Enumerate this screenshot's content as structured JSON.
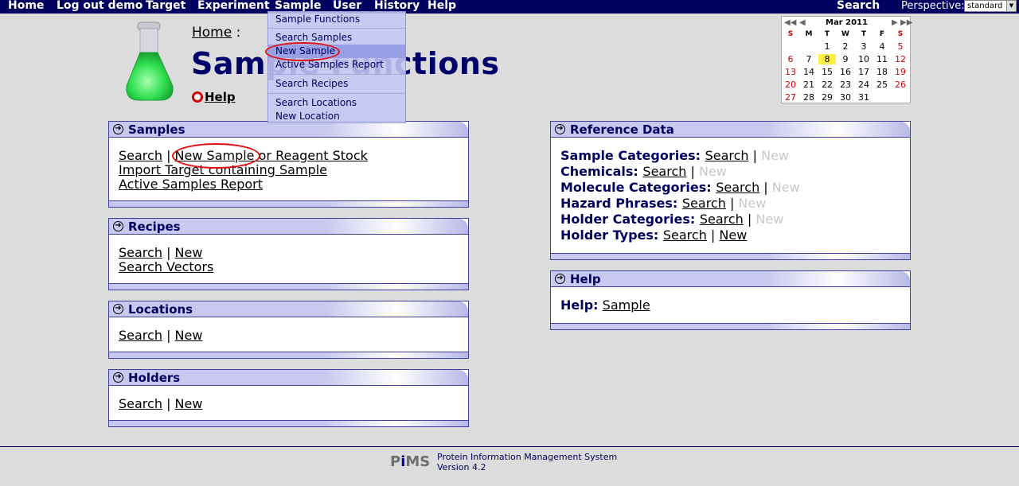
{
  "nav": {
    "items": [
      "Home",
      "Log out demo",
      "Target",
      "Experiment",
      "Sample",
      "User",
      "History",
      "Help"
    ],
    "search": "Search",
    "perspective_label": "Perspective:",
    "perspective_value": "standard"
  },
  "dropdown": {
    "items": [
      "Sample Functions",
      "Search Samples",
      "New Sample",
      "Active Samples Report",
      "Search Recipes",
      "Search Locations",
      "New Location"
    ],
    "highlighted": "New Sample"
  },
  "header": {
    "breadcrumb": "Home",
    "breadcrumb_sep": ":",
    "title": "Sample Functions",
    "help": "Help"
  },
  "calendar": {
    "month": "Mar 2011",
    "dow": [
      "S",
      "M",
      "T",
      "W",
      "T",
      "F",
      "S"
    ],
    "weeks": [
      [
        "",
        "",
        "1",
        "2",
        "3",
        "4",
        "5"
      ],
      [
        "6",
        "7",
        "8",
        "9",
        "10",
        "11",
        "12"
      ],
      [
        "13",
        "14",
        "15",
        "16",
        "17",
        "18",
        "19"
      ],
      [
        "20",
        "21",
        "22",
        "23",
        "24",
        "25",
        "26"
      ],
      [
        "27",
        "28",
        "29",
        "30",
        "31",
        "",
        ""
      ]
    ],
    "today": "8"
  },
  "panels": {
    "samples": {
      "title": "Samples",
      "search": "Search",
      "new_sample": "New Sample",
      "reagent_suffix": " or Reagent Stock",
      "import_target": "Import Target containing Sample",
      "active_report": "Active Samples Report"
    },
    "recipes": {
      "title": "Recipes",
      "search": "Search",
      "new": "New",
      "search_vectors": "Search Vectors"
    },
    "locations": {
      "title": "Locations",
      "search": "Search",
      "new": "New"
    },
    "holders": {
      "title": "Holders",
      "search": "Search",
      "new": "New"
    },
    "reference": {
      "title": "Reference Data",
      "rows": [
        {
          "label": "Sample Categories:",
          "search": "Search",
          "new": "New",
          "new_enabled": false
        },
        {
          "label": "Chemicals:",
          "search": "Search",
          "new": "New",
          "new_enabled": false
        },
        {
          "label": "Molecule Categories:",
          "search": "Search",
          "new": "New",
          "new_enabled": false
        },
        {
          "label": "Hazard Phrases:",
          "search": "Search",
          "new": "New",
          "new_enabled": false
        },
        {
          "label": "Holder Categories:",
          "search": "Search",
          "new": "New",
          "new_enabled": false
        },
        {
          "label": "Holder Types:",
          "search": "Search",
          "new": "New",
          "new_enabled": true
        }
      ]
    },
    "help": {
      "title": "Help",
      "label": "Help:",
      "link": "Sample"
    }
  },
  "footer": {
    "logo": "PiMS",
    "line1": "Protein Information Management System",
    "line2": "Version 4.2"
  },
  "colors": {
    "nav_bg": "#00005e",
    "title": "#00006a",
    "annotation": "#e01010",
    "today": "#ffee44"
  }
}
